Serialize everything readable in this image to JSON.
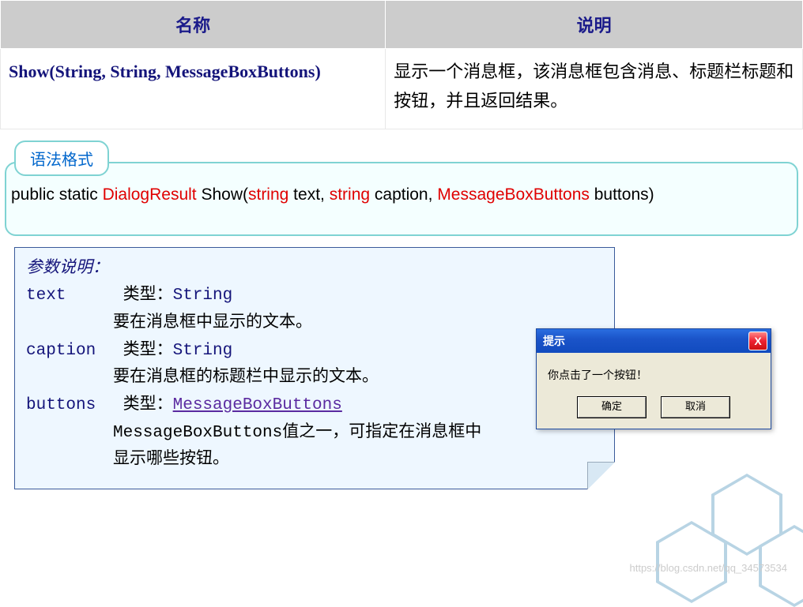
{
  "table": {
    "headers": {
      "name": "名称",
      "desc": "说明"
    },
    "row": {
      "signature": "Show(String, String, MessageBoxButtons)",
      "description": "显示一个消息框，该消息框包含消息、标题栏标题和按钮，并且返回结果。"
    }
  },
  "syntax": {
    "tab_label": "语法格式",
    "parts": {
      "p1": "public static ",
      "p2": "DialogResult",
      "p3": " Show(",
      "p4": "string",
      "p5": " text, ",
      "p6": "string",
      "p7": " caption,  ",
      "p8": "MessageBoxButtons",
      "p9": " buttons)"
    }
  },
  "params": {
    "title": "参数说明：",
    "items": [
      {
        "name": "text",
        "type_prefix": "类型：",
        "type": "String",
        "desc": "要在消息框中显示的文本。"
      },
      {
        "name": "caption",
        "type_prefix": "类型：",
        "type": "String",
        "desc": "要在消息框的标题栏中显示的文本。"
      },
      {
        "name": "buttons",
        "type_prefix": "类型：",
        "type_link": "MessageBoxButtons",
        "desc_line1": "MessageBoxButtons值之一，可指定在消息框中",
        "desc_line2": "显示哪些按钮。"
      }
    ]
  },
  "dialog": {
    "title": "提示",
    "message": "你点击了一个按钮！",
    "ok": "确定",
    "cancel": "取消",
    "close": "X"
  },
  "watermark": "https://blog.csdn.net/qq_34573534"
}
